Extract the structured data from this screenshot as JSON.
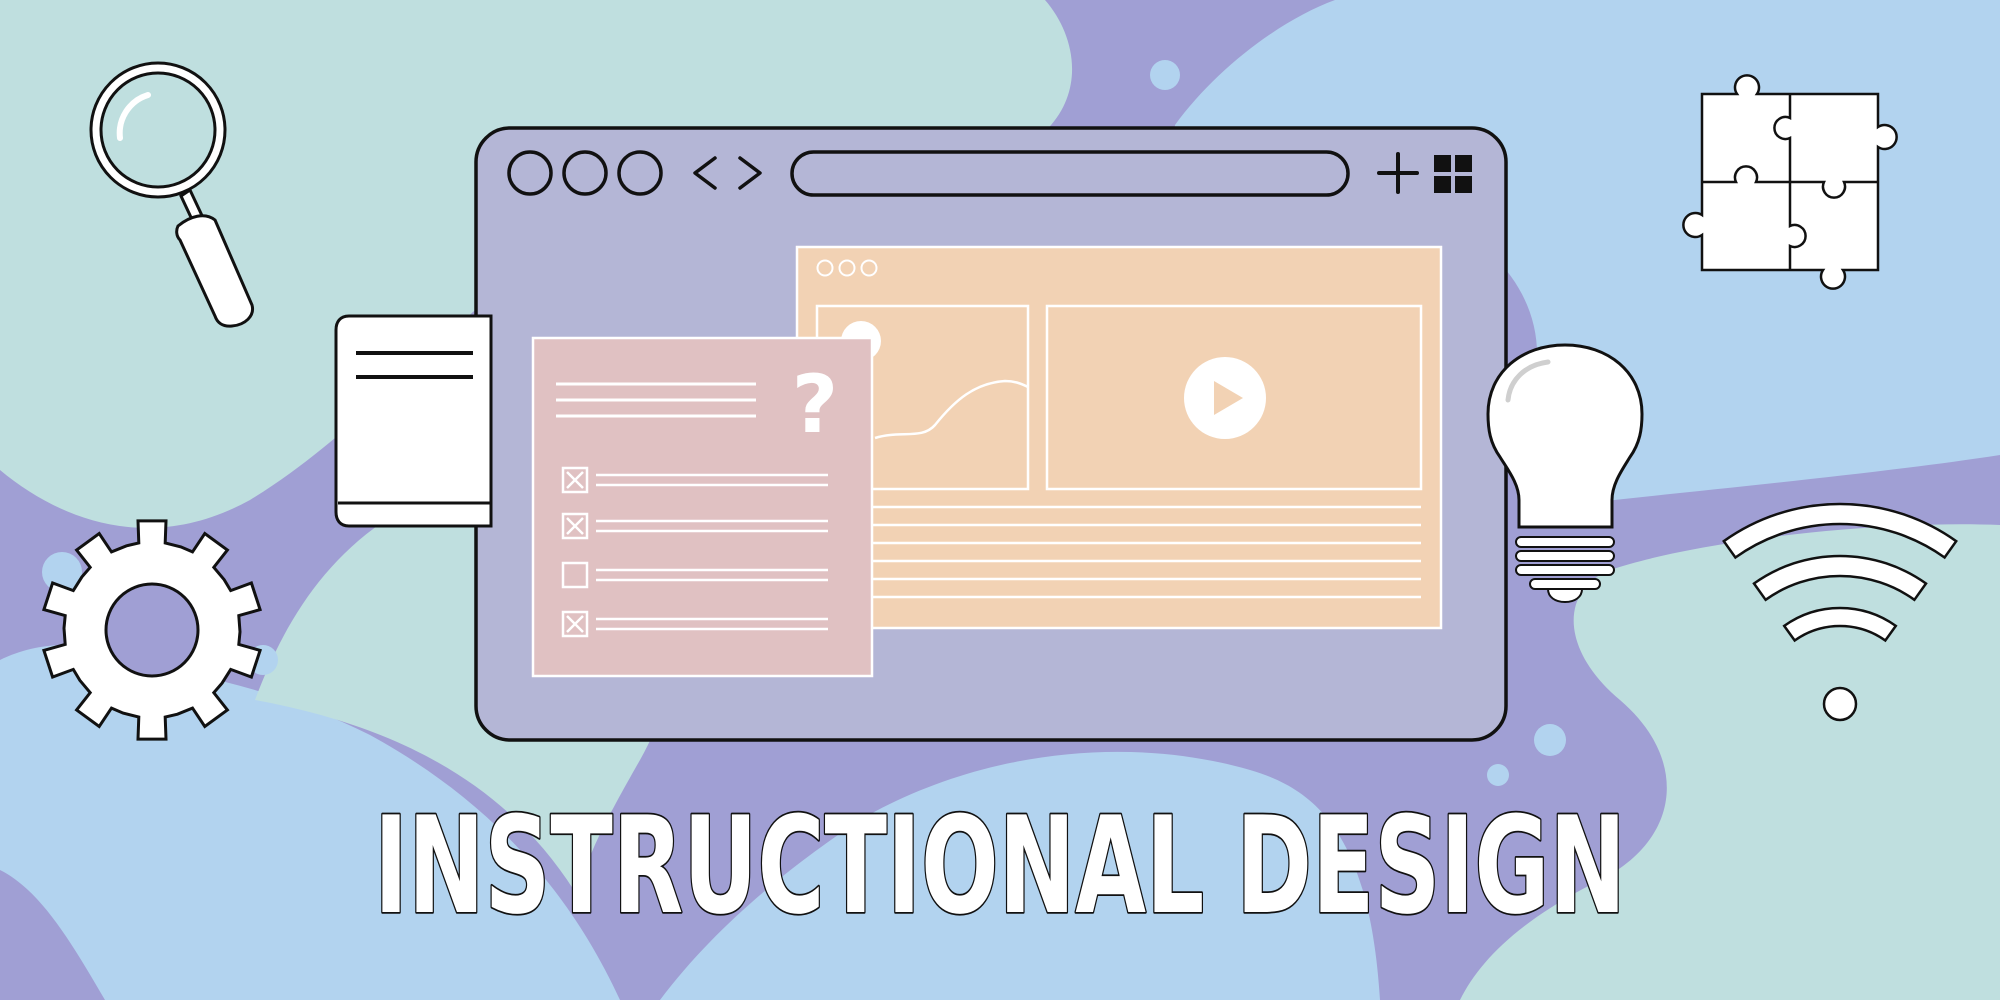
{
  "title": "INSTRUCTIONAL DESIGN",
  "colors": {
    "background_purple": "#a09fd4",
    "blob_mint": "#bfdfdf",
    "blob_sky": "#b2d3ef",
    "browser_window": "#b4b6d6",
    "content_panel": "#f2d2b4",
    "quiz_card": "#e0c1c2",
    "outline": "#111111",
    "white": "#ffffff"
  },
  "icons": {
    "magnifier": "magnifying-glass-icon",
    "gear": "gear-icon",
    "book": "book-icon",
    "puzzle": "puzzle-icon",
    "bulb": "lightbulb-icon",
    "wifi": "wifi-icon",
    "play": "play-icon",
    "question": "question-mark-icon",
    "add": "plus-icon",
    "grid": "grid-icon",
    "nav": "code-arrows-icon"
  },
  "quiz": {
    "question_mark": "?",
    "items": [
      {
        "checked": true
      },
      {
        "checked": true
      },
      {
        "checked": false
      },
      {
        "checked": true
      }
    ]
  }
}
